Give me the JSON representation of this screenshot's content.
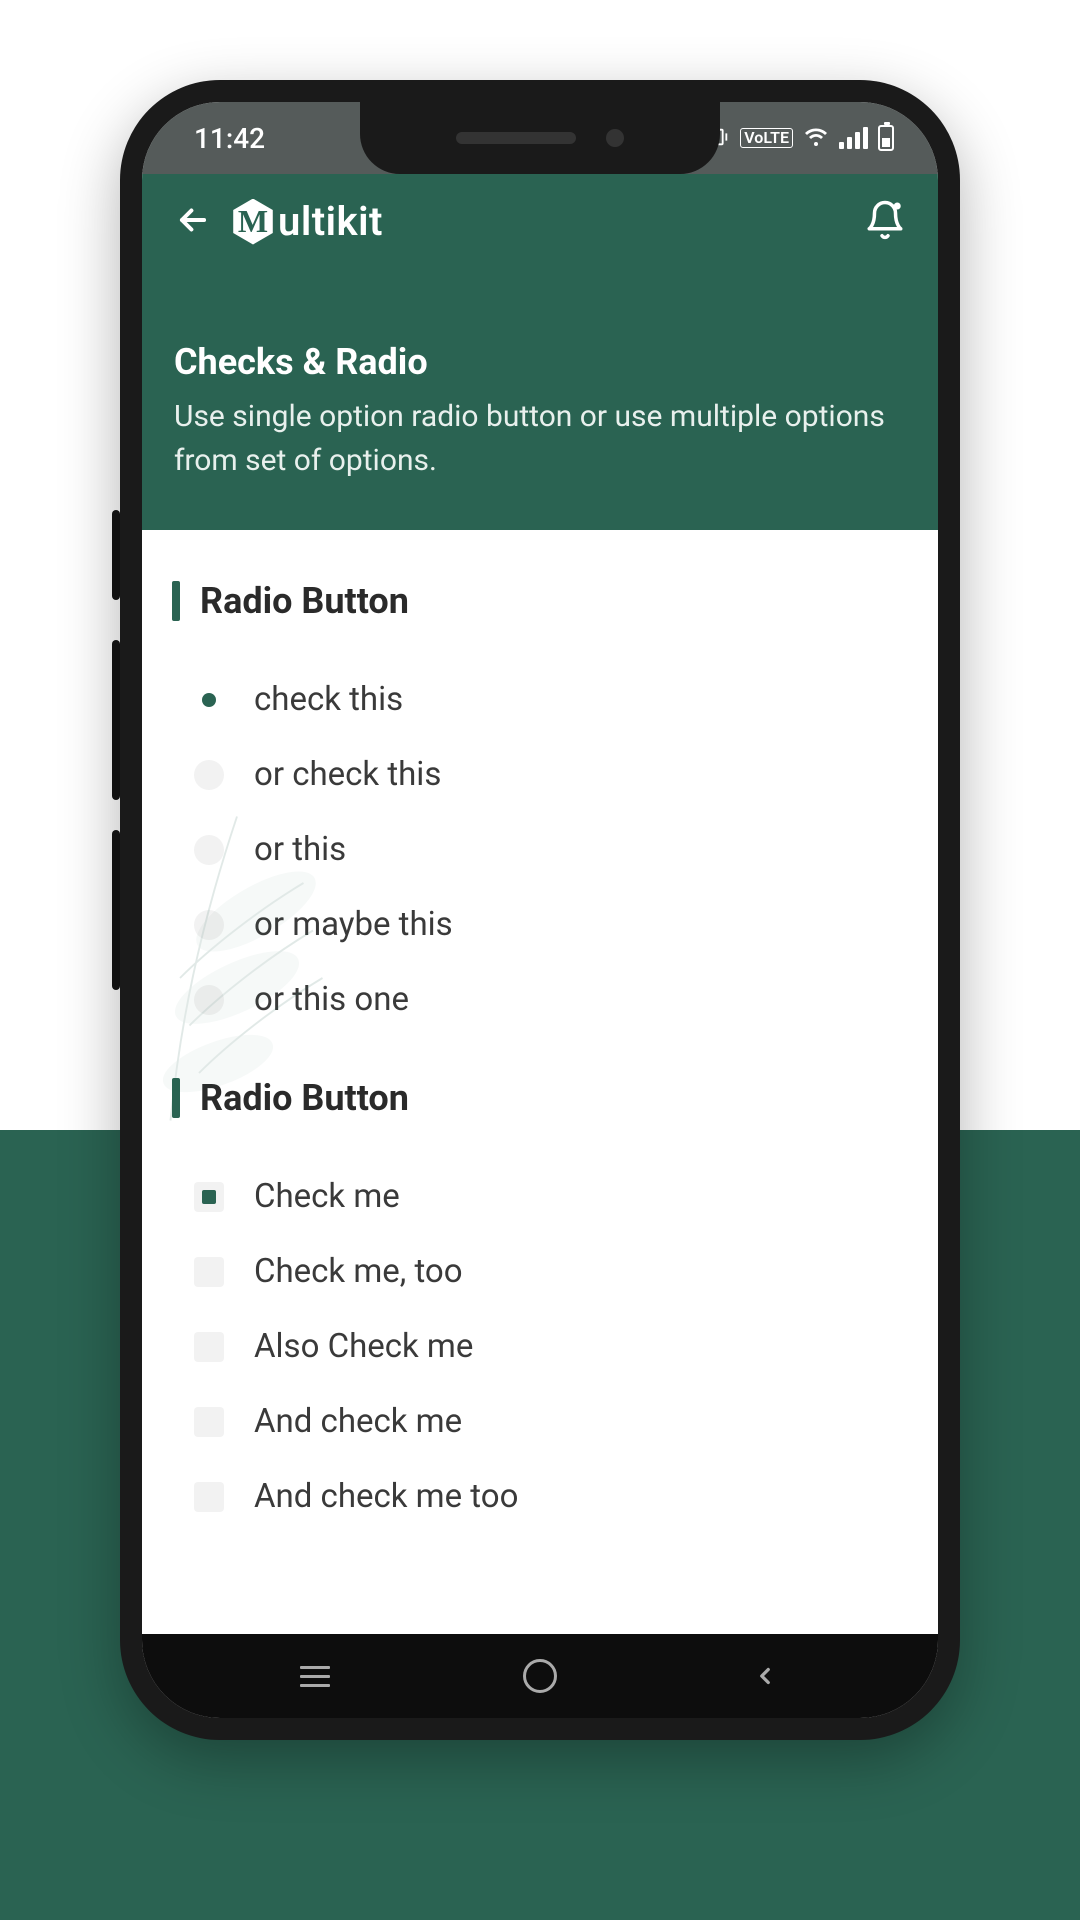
{
  "status": {
    "time": "11:42",
    "lte": "VoLTE"
  },
  "header": {
    "app_name": "ultikit"
  },
  "page": {
    "title": "Checks & Radio",
    "subtitle": "Use single option radio button or use multiple options from set of options."
  },
  "sections": [
    {
      "title": "Radio Button",
      "type": "radio",
      "options": [
        {
          "label": "check this",
          "selected": true
        },
        {
          "label": "or check this",
          "selected": false
        },
        {
          "label": "or this",
          "selected": false
        },
        {
          "label": "or maybe this",
          "selected": false
        },
        {
          "label": "or this one",
          "selected": false
        }
      ]
    },
    {
      "title": "Radio Button",
      "type": "checkbox",
      "options": [
        {
          "label": "Check me",
          "selected": true
        },
        {
          "label": "Check me,  too",
          "selected": false
        },
        {
          "label": "Also Check me",
          "selected": false
        },
        {
          "label": "And check me",
          "selected": false
        },
        {
          "label": "And check me too",
          "selected": false
        }
      ]
    }
  ],
  "colors": {
    "primary": "#2a6352"
  }
}
